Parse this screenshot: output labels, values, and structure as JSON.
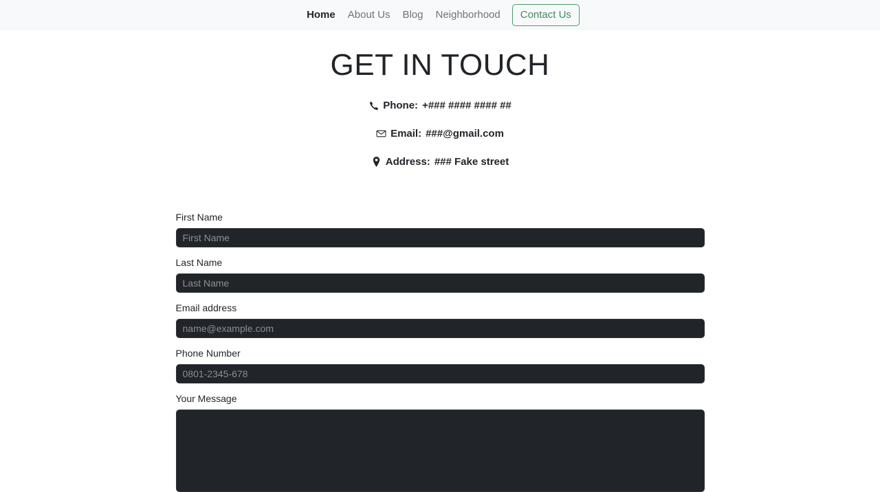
{
  "nav": {
    "items": [
      {
        "label": "Home",
        "active": true
      },
      {
        "label": "About Us",
        "active": false
      },
      {
        "label": "Blog",
        "active": false
      },
      {
        "label": "Neighborhood",
        "active": false
      }
    ],
    "cta_label": "Contact Us",
    "cta_color": "#4a9b68"
  },
  "page": {
    "title": "GET IN TOUCH"
  },
  "contact": {
    "phone": {
      "icon": "phone-icon",
      "label": "Phone:",
      "value": "+### #### #### ##"
    },
    "email": {
      "icon": "envelope-icon",
      "label": "Email:",
      "value": "###@gmail.com"
    },
    "address": {
      "icon": "map-pin-icon",
      "label": "Address:",
      "value": "### Fake street"
    }
  },
  "form": {
    "first_name": {
      "label": "First Name",
      "placeholder": "First Name",
      "value": ""
    },
    "last_name": {
      "label": "Last Name",
      "placeholder": "Last Name",
      "value": ""
    },
    "email": {
      "label": "Email address",
      "placeholder": "name@example.com",
      "value": ""
    },
    "phone": {
      "label": "Phone Number",
      "placeholder": "0801-2345-678",
      "value": ""
    },
    "message": {
      "label": "Your Message",
      "placeholder": "",
      "value": ""
    }
  }
}
